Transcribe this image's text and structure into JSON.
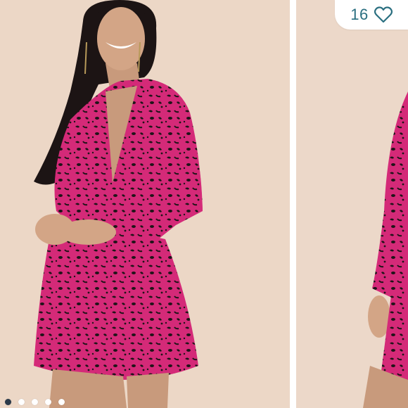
{
  "listing": {
    "like_count": "16",
    "like_icon": "heart-outline-icon",
    "accent_color": "#2a6f80"
  },
  "carousel": {
    "slide_count": 5,
    "active_index": 0,
    "dot_active_color": "#2b3a4a",
    "dot_inactive_color": "#ffffff"
  },
  "photo": {
    "background_color": "#ecd7c6",
    "dress_color": "#d42a78",
    "print_color": "#1e1418"
  }
}
